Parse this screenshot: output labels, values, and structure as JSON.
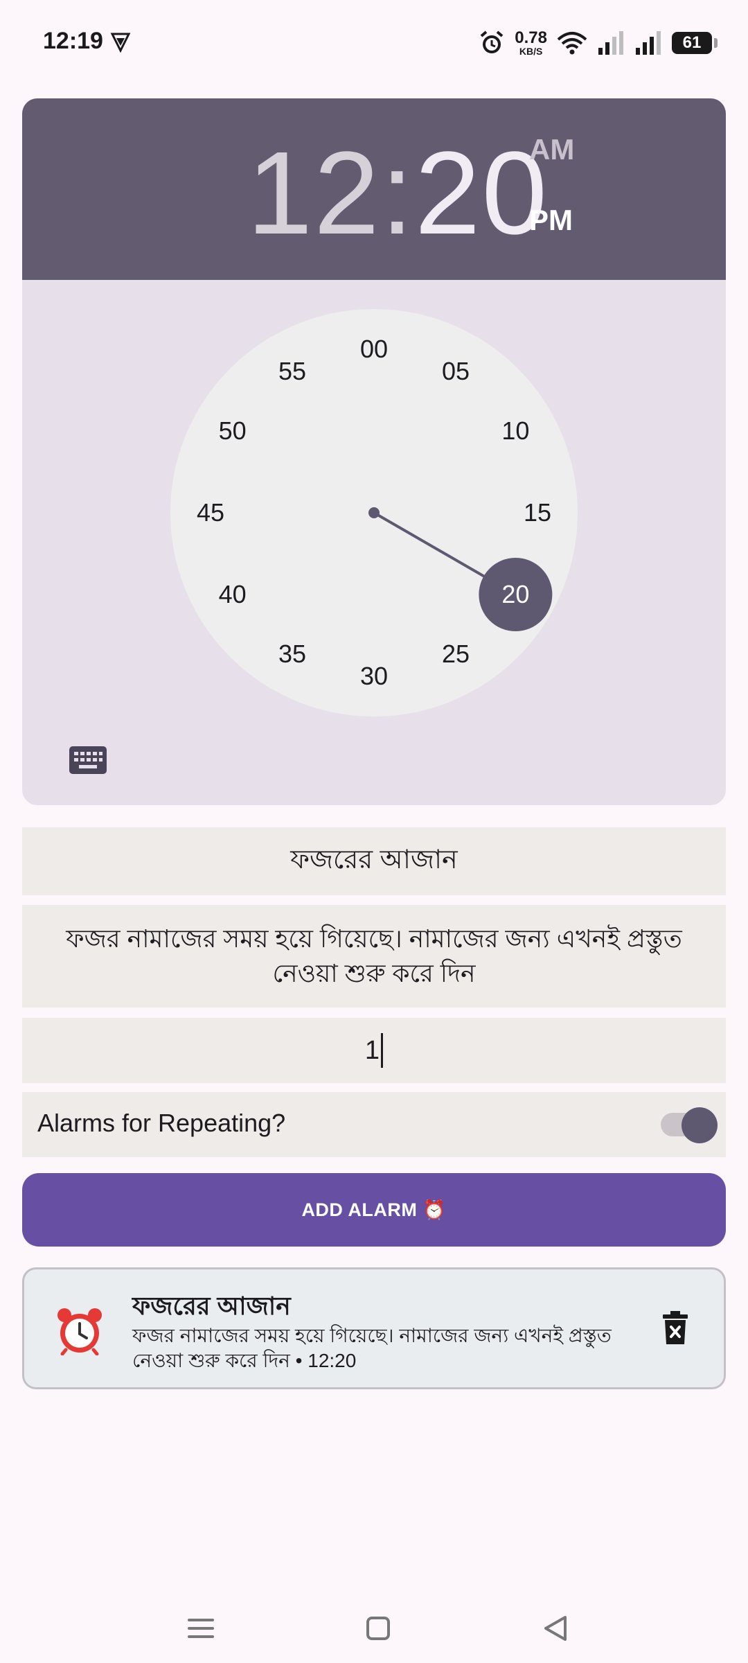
{
  "status_bar": {
    "time": "12:19",
    "speed_value": "0.78",
    "speed_unit": "KB/S",
    "battery": "61"
  },
  "time_picker": {
    "hour": "12",
    "separator": ":",
    "minute": "20",
    "am_label": "AM",
    "pm_label": "PM",
    "selected_period": "PM",
    "dial_numbers": [
      "00",
      "05",
      "10",
      "15",
      "20",
      "25",
      "30",
      "35",
      "40",
      "45",
      "50",
      "55"
    ],
    "selected_minute": "20",
    "colors": {
      "header": "#635b70",
      "body": "#e7e0eb",
      "dial": "#eeeeee",
      "hand": "#5e5870"
    },
    "keyboard_icon": "keyboard-icon"
  },
  "form": {
    "title_value": "ফজরের আজান",
    "message_value": "ফজর নামাজের সময় হয়ে গিয়েছে। নামাজের জন্য এখনই প্রস্তুত নেওয়া শুরু করে দিন",
    "count_value": "1",
    "repeat_label": "Alarms for Repeating?",
    "repeat_enabled": true,
    "add_button": "ADD ALARM ⏰"
  },
  "alarms": [
    {
      "icon": "alarm-clock-icon",
      "title": "ফজরের আজান",
      "subtitle": "ফজর নামাজের সময় হয়ে গিয়েছে। নামাজের জন্য এখনই প্রস্তুত নেওয়া শুরু করে দিন • 12:20",
      "delete_icon": "trash-icon"
    }
  ],
  "nav": {
    "items": [
      "menu-icon",
      "home-icon",
      "back-icon"
    ]
  }
}
